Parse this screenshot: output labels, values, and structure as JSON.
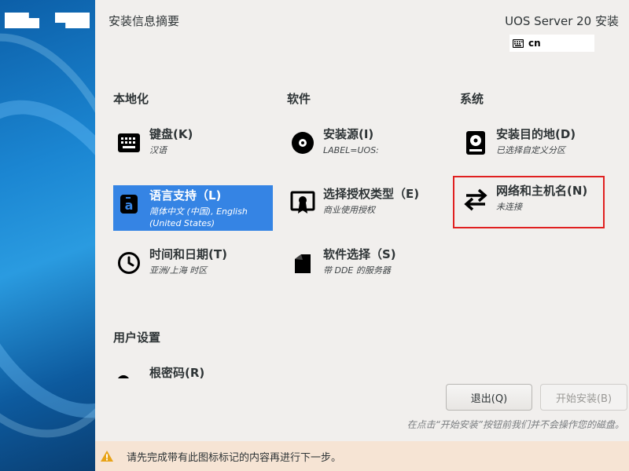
{
  "header": {
    "title": "安装信息摘要",
    "product": "UOS Server 20 安装",
    "keyboard_layout": "cn"
  },
  "categories": {
    "localization": "本地化",
    "software": "软件",
    "system": "系统",
    "user_settings": "用户设置"
  },
  "spokes": {
    "keyboard": {
      "title": "键盘(K)",
      "status": "汉语",
      "icon": "keyboard-icon"
    },
    "language": {
      "title": "语言支持（L)",
      "status": "简体中文 (中国), English (United States)",
      "icon": "language-icon"
    },
    "datetime": {
      "title": "时间和日期(T)",
      "status": "亚洲/上海 时区",
      "icon": "clock-icon"
    },
    "source": {
      "title": "安装源(I)",
      "status": "LABEL=UOS:",
      "icon": "disc-icon"
    },
    "license": {
      "title": "选择授权类型（E)",
      "status": "商业使用授权",
      "icon": "certificate-icon"
    },
    "software": {
      "title": "软件选择（S)",
      "status": "带 DDE 的服务器",
      "icon": "package-icon"
    },
    "destination": {
      "title": "安装目的地(D)",
      "status": "已选择自定义分区",
      "icon": "hard-disk-icon"
    },
    "network": {
      "title": "网络和主机名(N)",
      "status": "未连接",
      "icon": "network-arrows-icon"
    },
    "root": {
      "title": "根密码(R)",
      "icon": "key-icon"
    }
  },
  "buttons": {
    "quit": "退出(Q)",
    "begin": "开始安装(B)"
  },
  "hint": "在点击“开始安装”按钮前我们并不会操作您的磁盘。",
  "warning": "请先完成带有此图标标记的内容再进行下一步。",
  "colors": {
    "selected": "#3584e4",
    "highlight_border": "#e02020",
    "warning_bg": "#f6e4d4",
    "warning_icon": "#e8a317"
  }
}
